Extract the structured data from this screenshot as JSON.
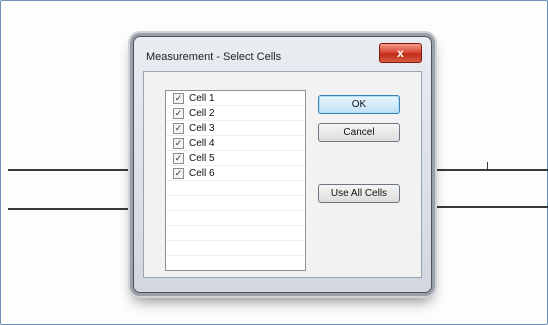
{
  "dialog": {
    "title": "Measurement - Select Cells",
    "close_glyph": "x"
  },
  "cells": [
    {
      "label": "Cell 1",
      "checked": true
    },
    {
      "label": "Cell 2",
      "checked": true
    },
    {
      "label": "Cell 3",
      "checked": true
    },
    {
      "label": "Cell 4",
      "checked": true
    },
    {
      "label": "Cell 5",
      "checked": true
    },
    {
      "label": "Cell 6",
      "checked": true
    }
  ],
  "buttons": {
    "ok": "OK",
    "cancel": "Cancel",
    "use_all": "Use All Cells"
  },
  "check_glyph": "✓",
  "colors": {
    "close_button": "#d9493a",
    "default_button_border": "#3c7fb1"
  }
}
